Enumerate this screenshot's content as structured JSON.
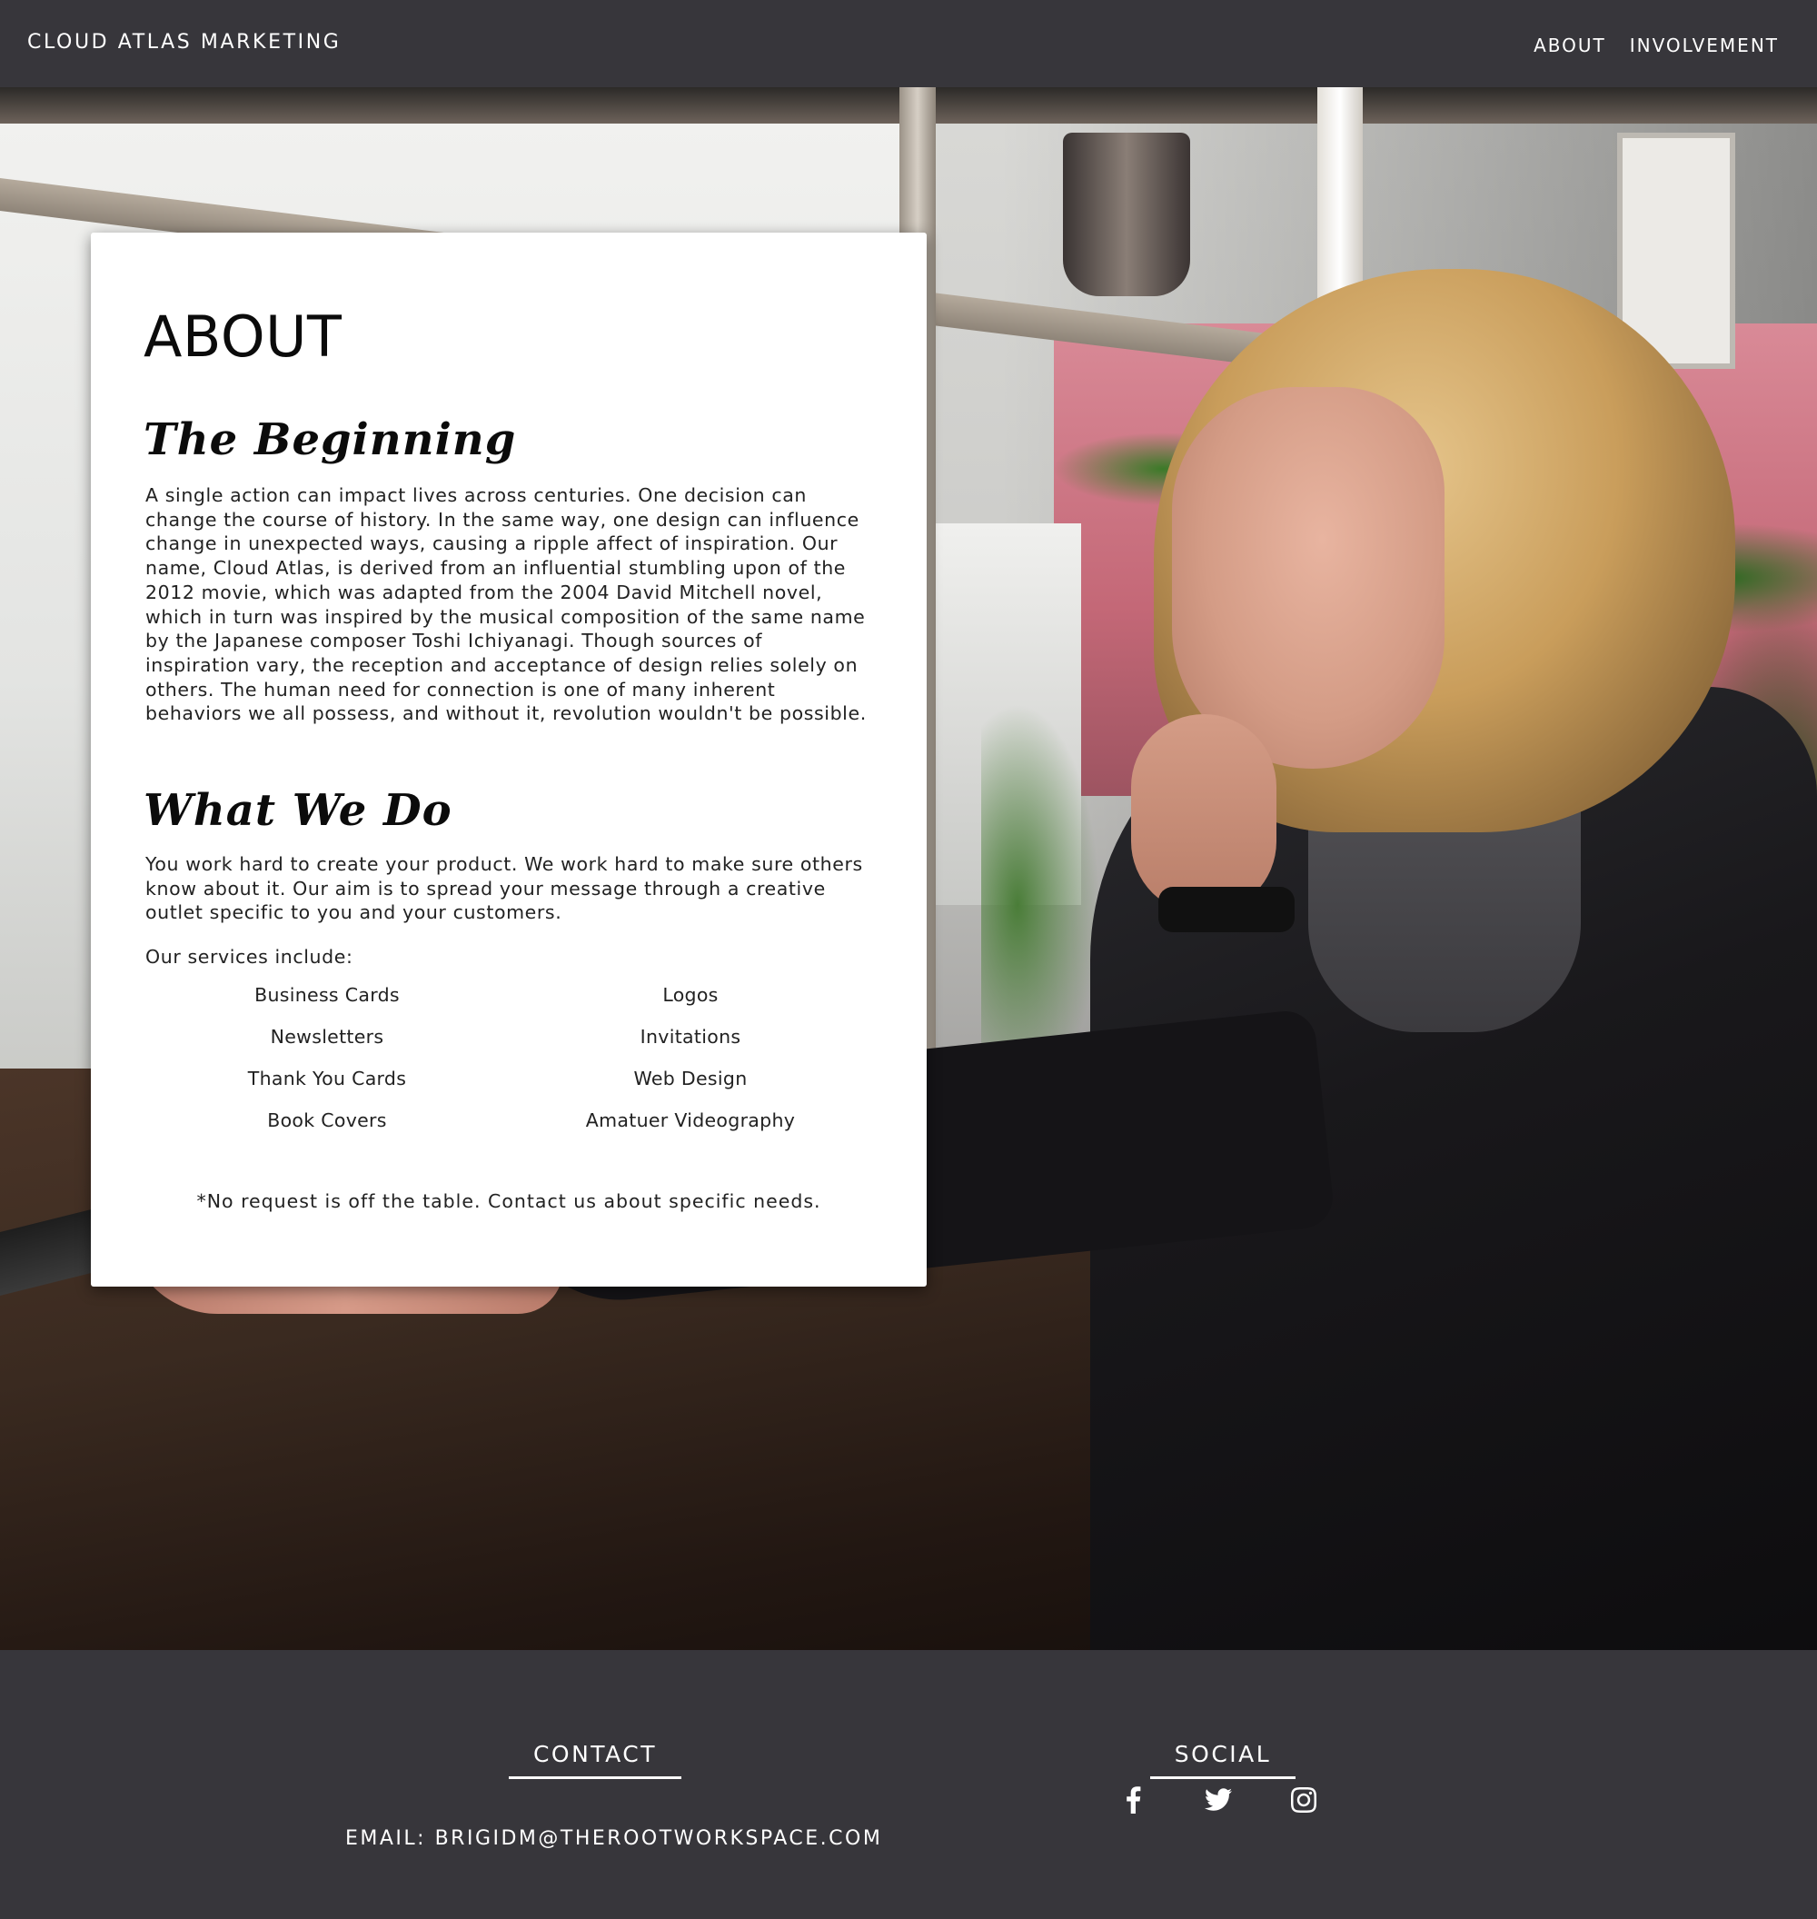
{
  "header": {
    "brand": "CLOUD ATLAS MARKETING",
    "nav": [
      {
        "label": "ABOUT"
      },
      {
        "label": "INVOLVEMENT"
      }
    ]
  },
  "about": {
    "title": "ABOUT",
    "beginning": {
      "heading": "The Beginning",
      "text": "A single action can impact lives across centuries. One decision can change the course of history. In the same way, one design can influence change in unexpected ways, causing a ripple affect of inspiration. Our name, Cloud Atlas, is derived from an influential stumbling upon of the 2012 movie, which was adapted from the 2004 David Mitchell novel, which in turn was inspired by the musical composition of the same name by the Japanese composer Toshi Ichiyanagi. Though sources of inspiration vary, the reception and acceptance of design relies solely on others. The human need for connection is one of many inherent behaviors we all possess, and without it, revolution wouldn't be possible."
    },
    "what_we_do": {
      "heading": "What We Do",
      "text": "You work hard to create your product. We work hard to make sure others know about it. Our aim is to spread your message through a creative outlet specific to you and your customers.",
      "services_intro": "Our services include:",
      "services": [
        "Business Cards",
        "Logos",
        "Newsletters",
        "Invitations",
        "Thank You Cards",
        "Web Design",
        "Book Covers",
        "Amatuer Videography"
      ],
      "note": "*No request is off the table. Contact us about specific needs."
    }
  },
  "footer": {
    "contact_heading": "CONTACT",
    "email": "EMAIL: BRIGIDM@THEROOTWORKSPACE.COM",
    "social_heading": "SOCIAL",
    "social_icons": [
      "facebook-icon",
      "twitter-icon",
      "instagram-icon"
    ]
  },
  "colors": {
    "header_bg": "#37363b",
    "footer_bg": "#37363b",
    "card_bg": "#ffffff",
    "text_light": "#ffffff",
    "text_dark": "#111111"
  }
}
